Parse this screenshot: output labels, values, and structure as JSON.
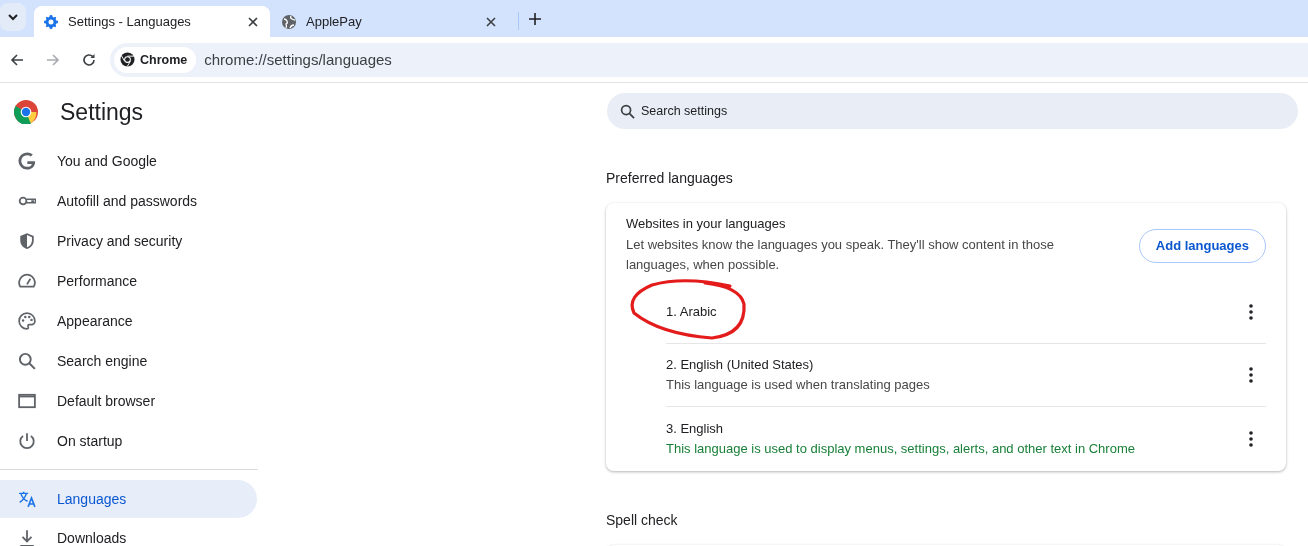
{
  "browser": {
    "tabs": [
      {
        "title": "Settings - Languages",
        "selected": true
      },
      {
        "title": "ApplePay",
        "selected": false
      }
    ],
    "address_bar": {
      "chip": "Chrome",
      "url": "chrome://settings/languages"
    }
  },
  "sidebar": {
    "title": "Settings",
    "items": [
      {
        "label": "You and Google",
        "selected": false
      },
      {
        "label": "Autofill and passwords",
        "selected": false
      },
      {
        "label": "Privacy and security",
        "selected": false
      },
      {
        "label": "Performance",
        "selected": false
      },
      {
        "label": "Appearance",
        "selected": false
      },
      {
        "label": "Search engine",
        "selected": false
      },
      {
        "label": "Default browser",
        "selected": false
      },
      {
        "label": "On startup",
        "selected": false
      },
      {
        "label": "Languages",
        "selected": true,
        "group_start": true
      },
      {
        "label": "Downloads",
        "selected": false
      }
    ]
  },
  "search": {
    "placeholder": "Search settings"
  },
  "sections": [
    {
      "heading": "Preferred languages",
      "card": {
        "title": "Websites in your languages",
        "description": "Let websites know the languages you speak. They'll show content in those languages, when possible.",
        "button": "Add languages",
        "languages": [
          {
            "name": "1. Arabic",
            "kind": "plain"
          },
          {
            "name": "2. English (United States)",
            "note": "This language is used when translating pages",
            "kind": "plain"
          },
          {
            "name": "3. English",
            "note": "This language is used to display menus, settings, alerts, and other text in Chrome",
            "kind": "ui"
          }
        ]
      }
    },
    {
      "heading": "Spell check"
    }
  ],
  "annotation": {
    "kind": "circle"
  }
}
